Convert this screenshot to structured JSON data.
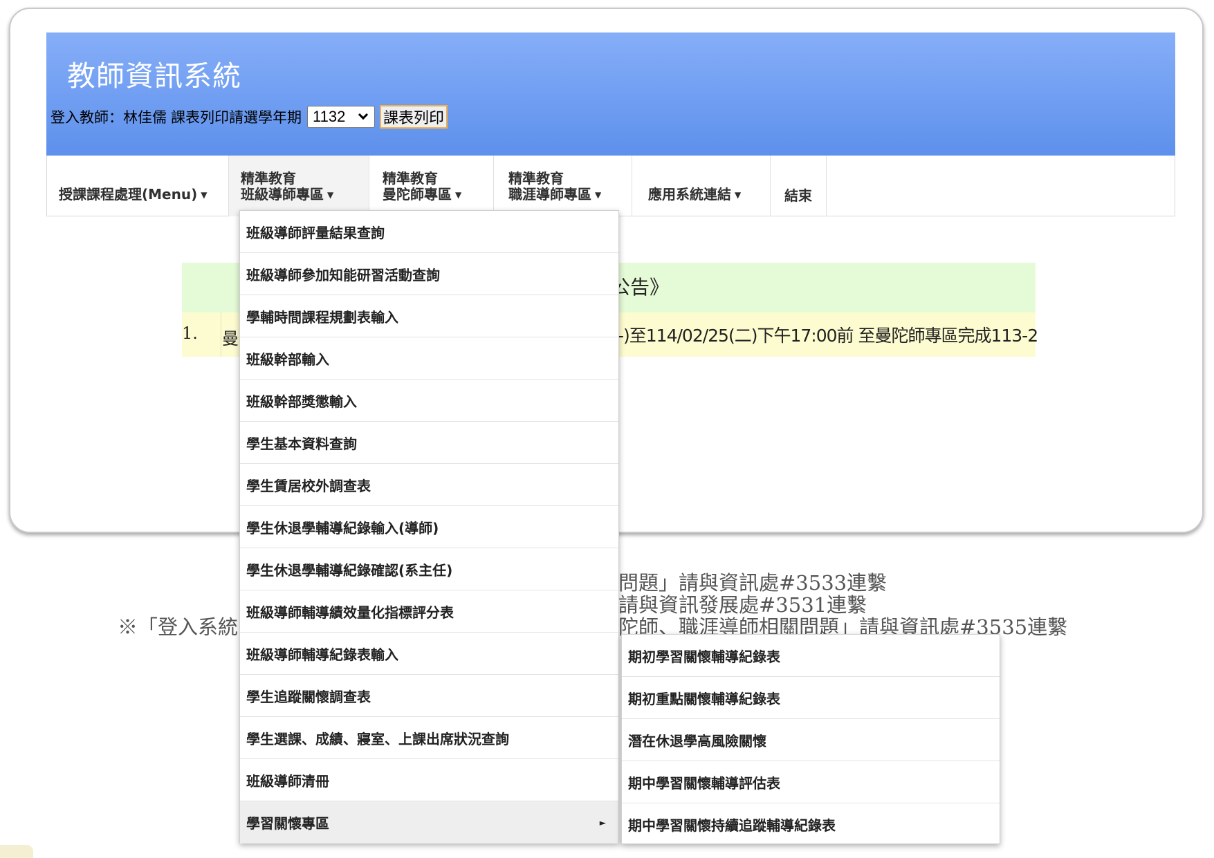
{
  "header": {
    "title": "教師資訊系統",
    "login_label": "登入教師：林佳儒",
    "print_prompt": "課表列印請選學年期",
    "term_value": "1132",
    "print_button": "課表列印"
  },
  "nav": {
    "items": [
      {
        "line1": "",
        "line2": "授課課程處理(Menu)"
      },
      {
        "line1": "精準教育",
        "line2": "班級導師專區"
      },
      {
        "line1": "精準教育",
        "line2": "曼陀師專區"
      },
      {
        "line1": "精準教育",
        "line2": "職涯導師專區"
      },
      {
        "line1": "",
        "line2": "應用系統連結"
      },
      {
        "line1": "",
        "line2": "結束"
      }
    ]
  },
  "notice": {
    "heading_fragment": "公告》",
    "row_number": "1.",
    "row_text_start": "曼",
    "row_text_tail": "-)至114/02/25(二)下午17:00前 至曼陀師專區完成113-2"
  },
  "footnotes": {
    "line1": "問題」請與資訊處#3533連繫",
    "line2": "請與資訊發展處#3531連繫",
    "line3": "※「登入系統",
    "line3_tail": "陀師、職涯導師相關問題」請與資訊處#3535連繫"
  },
  "dropdown": {
    "items": [
      "班級導師評量結果查詢",
      "班級導師參加知能研習活動查詢",
      "學輔時間課程規劃表輸入",
      "班級幹部輸入",
      "班級幹部獎懲輸入",
      "學生基本資料查詢",
      "學生賃居校外調查表",
      "學生休退學輔導紀錄輸入(導師)",
      "學生休退學輔導紀錄確認(系主任)",
      "班級導師輔導績效量化指標評分表",
      "班級導師輔導紀錄表輸入",
      "學生追蹤關懷調查表",
      "學生選課、成績、寢室、上課出席狀況查詢",
      "班級導師清冊",
      "學習關懷專區"
    ]
  },
  "submenu": {
    "items": [
      "期初學習關懷輔導紀錄表",
      "期初重點關懷輔導紀錄表",
      "潛在休退學高風險關懷",
      "期中學習關懷輔導評估表",
      "期中學習關懷持續追蹤輔導紀錄表"
    ]
  }
}
